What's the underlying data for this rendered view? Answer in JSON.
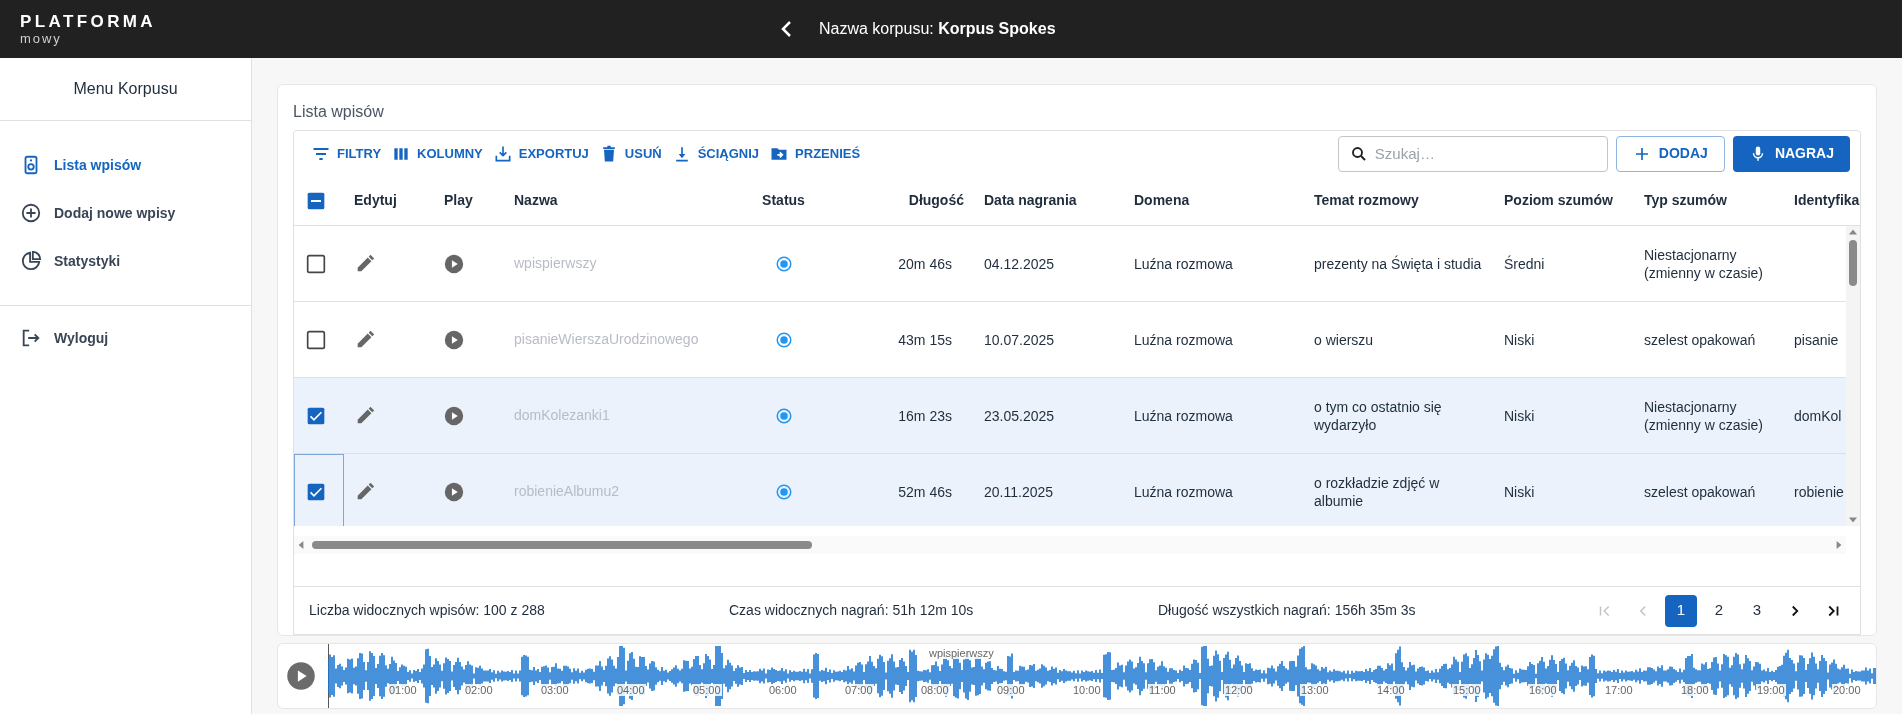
{
  "app": {
    "logo_title": "PLATFORMA",
    "logo_subtitle": "mowy"
  },
  "header": {
    "label": "Nazwa korpusu:",
    "corpus": "Korpus Spokes"
  },
  "sidebar": {
    "title": "Menu Korpusu",
    "items": [
      {
        "label": "Lista wpisów",
        "kind": "list",
        "selected": true
      },
      {
        "label": "Dodaj nowe wpisy",
        "kind": "add",
        "selected": false
      },
      {
        "label": "Statystyki",
        "kind": "stats",
        "selected": false
      }
    ],
    "logout": "Wyloguj"
  },
  "card": {
    "title": "Lista wpisów"
  },
  "toolbar": [
    {
      "label": "FILTRY",
      "kind": "filter"
    },
    {
      "label": "KOLUMNY",
      "kind": "columns"
    },
    {
      "label": "EXPORTUJ",
      "kind": "export"
    },
    {
      "label": "USUŃ",
      "kind": "delete"
    },
    {
      "label": "ŚCIĄGNIJ",
      "kind": "download"
    },
    {
      "label": "PRZENIEŚ",
      "kind": "move"
    }
  ],
  "search": {
    "placeholder": "Szukaj…"
  },
  "actions": [
    {
      "label": "DODAJ",
      "kind": "add"
    },
    {
      "label": "NAGRAJ",
      "kind": "record"
    }
  ],
  "table": {
    "select_all": {
      "indeterminate": true
    },
    "columns": [
      "Edytuj",
      "Play",
      "Nazwa",
      "Status",
      "Długość",
      "Data nagrania",
      "Domena",
      "Temat rozmowy",
      "Poziom szumów",
      "Typ szumów",
      "Identyfika"
    ],
    "rows": [
      {
        "selected": false,
        "focused": false,
        "name": "wpispierwszy",
        "length": "20m 46s",
        "date": "04.12.2025",
        "domain": "Luźna rozmowa",
        "topic": "prezenty na Święta i studia",
        "noise_level": "Średni",
        "noise_type": "Niestacjonarny (zmienny w czasie)"
      },
      {
        "selected": false,
        "focused": false,
        "name": "pisanieWierszaUrodzinowego",
        "length": "43m 15s",
        "date": "10.07.2025",
        "domain": "Luźna rozmowa",
        "topic": "o wierszu",
        "noise_level": "Niski",
        "noise_type": "szelest opakowań",
        "identifier": "pisanie"
      },
      {
        "selected": true,
        "focused": false,
        "name": "domKolezanki1",
        "length": "16m 23s",
        "date": "23.05.2025",
        "domain": "Luźna rozmowa",
        "topic": "o tym co ostatnio się wydarzyło",
        "noise_level": "Niski",
        "noise_type": "Niestacjonarny (zmienny w czasie)",
        "identifier": "domKol"
      },
      {
        "selected": true,
        "focused": true,
        "name": "robienieAlbumu2",
        "length": "52m 46s",
        "date": "20.11.2025",
        "domain": "Luźna rozmowa",
        "topic": "o rozkładzie zdjęć w albumie",
        "noise_level": "Niski",
        "noise_type": "szelest opakowań",
        "identifier": "robienie"
      }
    ]
  },
  "footer": {
    "visible_count": "Liczba widocznych wpisów: 100 z 288",
    "visible_time": "Czas widocznych nagrań: 51h 12m 10s",
    "total_time": "Długość wszystkich nagrań: 156h 35m 3s",
    "pagination": [
      {
        "kind": "first",
        "disabled": true
      },
      {
        "kind": "prev",
        "disabled": true
      },
      {
        "kind": "page",
        "label": "1",
        "selected": true
      },
      {
        "kind": "page",
        "label": "2",
        "selected": false
      },
      {
        "kind": "page",
        "label": "3",
        "selected": false
      },
      {
        "kind": "next",
        "disabled": false
      },
      {
        "kind": "last",
        "disabled": false
      }
    ]
  },
  "player": {
    "track": "wpispierwszy",
    "ticks": [
      "01:00",
      "02:00",
      "03:00",
      "04:00",
      "05:00",
      "06:00",
      "07:00",
      "08:00",
      "09:00",
      "10:00",
      "11:00",
      "12:00",
      "13:00",
      "14:00",
      "15:00",
      "16:00",
      "17:00",
      "18:00",
      "19:00",
      "20:00"
    ]
  }
}
